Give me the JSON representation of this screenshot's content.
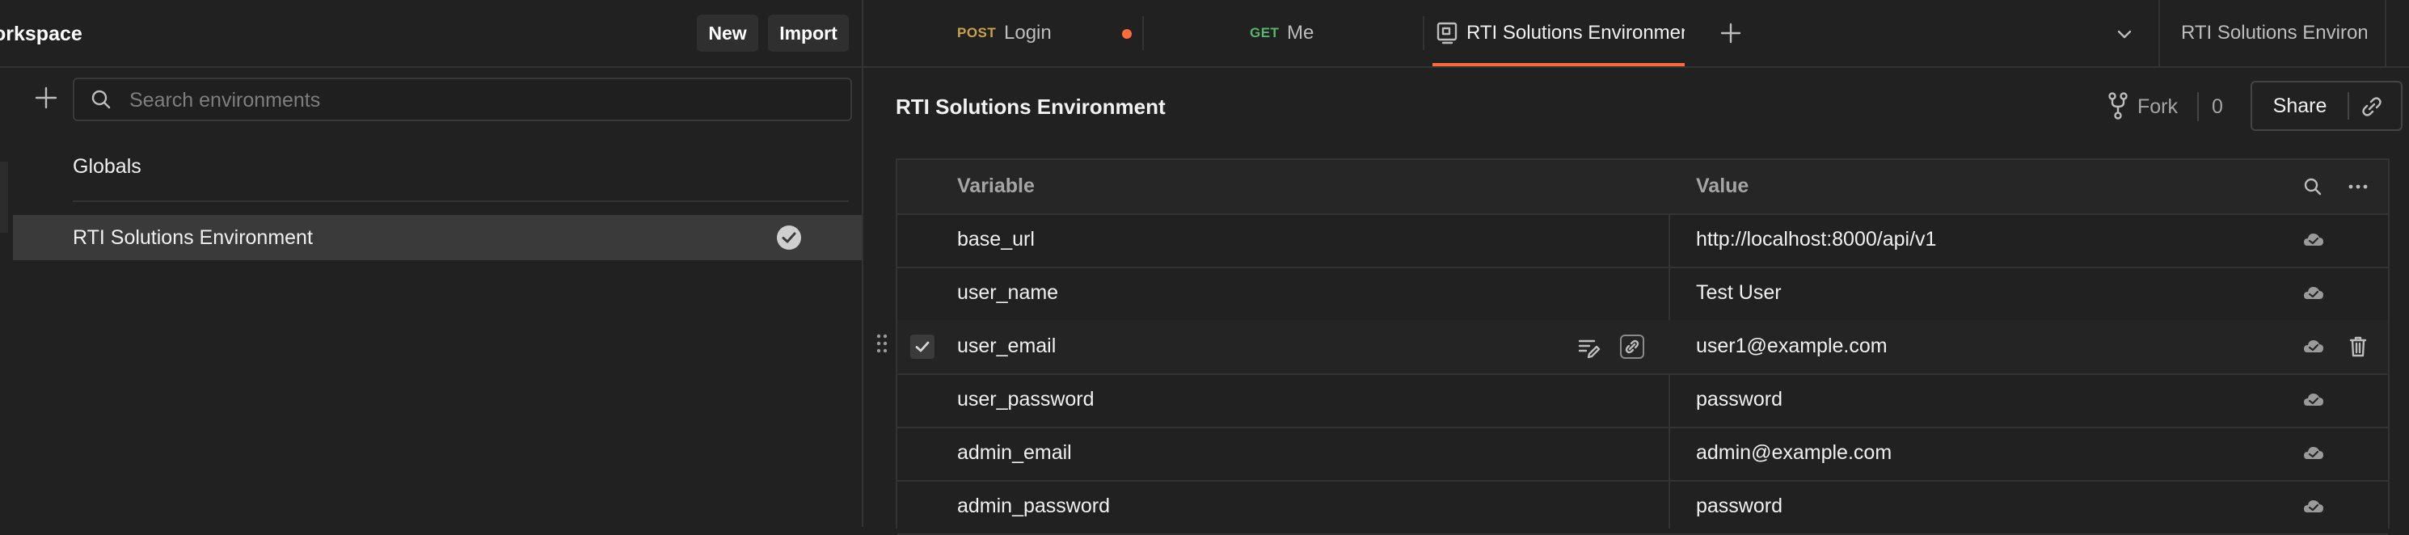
{
  "header": {
    "workspace_title": "orkspace",
    "new_label": "New",
    "import_label": "Import"
  },
  "tabs": [
    {
      "method": "POST",
      "method_color": "#c9a34a",
      "label": "Login",
      "unsaved": true
    },
    {
      "method": "GET",
      "method_color": "#59b56a",
      "label": "Me"
    },
    {
      "label": "RTI Solutions Environmen",
      "active": true
    }
  ],
  "environment_selector": {
    "value": "RTI Solutions Environ..."
  },
  "sidebar": {
    "search_placeholder": "Search environments",
    "items": [
      {
        "label": "Globals"
      },
      {
        "label": "RTI Solutions Environment",
        "selected": true,
        "active": true
      }
    ]
  },
  "main": {
    "title": "RTI Solutions Environment",
    "fork_label": "Fork",
    "fork_count": "0",
    "share_label": "Share",
    "table": {
      "headers": {
        "variable": "Variable",
        "value": "Value"
      },
      "rows": [
        {
          "variable": "base_url",
          "value": "http://localhost:8000/api/v1"
        },
        {
          "variable": "user_name",
          "value": "Test User"
        },
        {
          "variable": "user_email",
          "value": "user1@example.com",
          "checked": true,
          "hovered": true
        },
        {
          "variable": "user_password",
          "value": "password"
        },
        {
          "variable": "admin_email",
          "value": "admin@example.com"
        },
        {
          "variable": "admin_password",
          "value": "password"
        }
      ]
    }
  },
  "colors": {
    "background": "#212121",
    "active_tab_underline": "#ff6c37",
    "unsaved_dot": "#ff6c37"
  }
}
